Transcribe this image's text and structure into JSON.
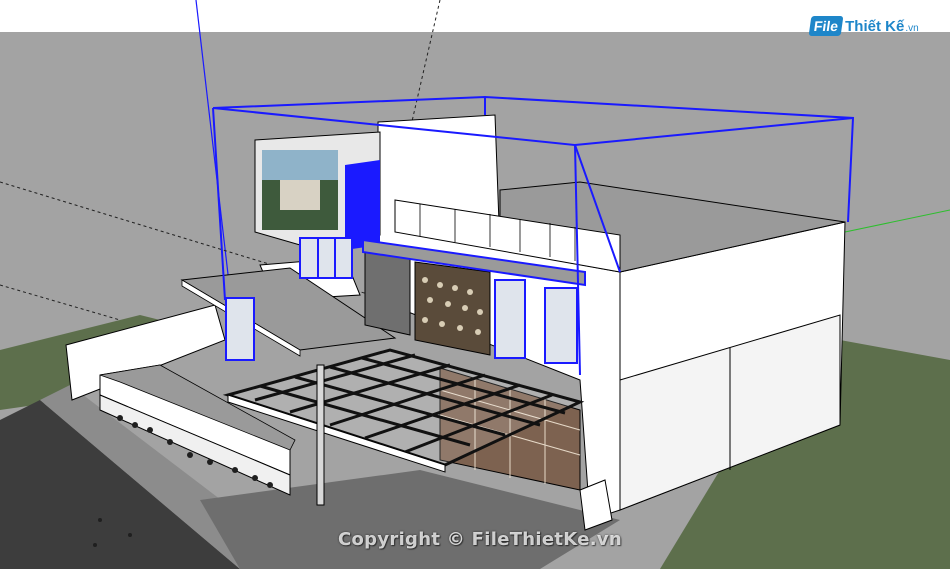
{
  "watermark": {
    "logo_box": "File",
    "logo_name": "Thiết Kế",
    "logo_suffix": ".vn",
    "copyright": "Copyright © FileThietKe.vn"
  },
  "viewport": {
    "sky_color": "#ffffff",
    "ground_color": "#a3a3a3",
    "lawn_color": "#5d6f4c",
    "selection_color": "#1a1aff"
  }
}
